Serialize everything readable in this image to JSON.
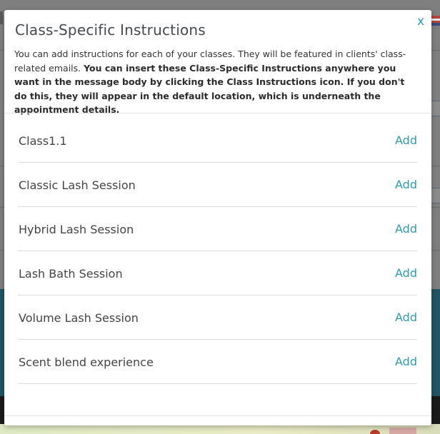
{
  "modal": {
    "title": "Class-Specific Instructions",
    "close_label": "x",
    "description": {
      "plain": "You can add instructions for each of your classes. They will be featured in clients' class-related emails. ",
      "bold": "You can insert these Class-Specific Instructions anywhere you want in the message body by clicking the Class Instructions icon. If you don't do this, they will appear in the default location, which is underneath the appointment details."
    },
    "classes": [
      {
        "name": "Class1.1",
        "action": "Add"
      },
      {
        "name": "Classic Lash Session",
        "action": "Add"
      },
      {
        "name": "Hybrid Lash Session",
        "action": "Add"
      },
      {
        "name": "Lash Bath Session",
        "action": "Add"
      },
      {
        "name": "Volume Lash Session",
        "action": "Add"
      },
      {
        "name": "Scent blend experience",
        "action": "Add"
      }
    ]
  },
  "colors": {
    "accent": "#2d9cb2",
    "overlay": "#7f7f7f",
    "band": "#1f5565"
  }
}
